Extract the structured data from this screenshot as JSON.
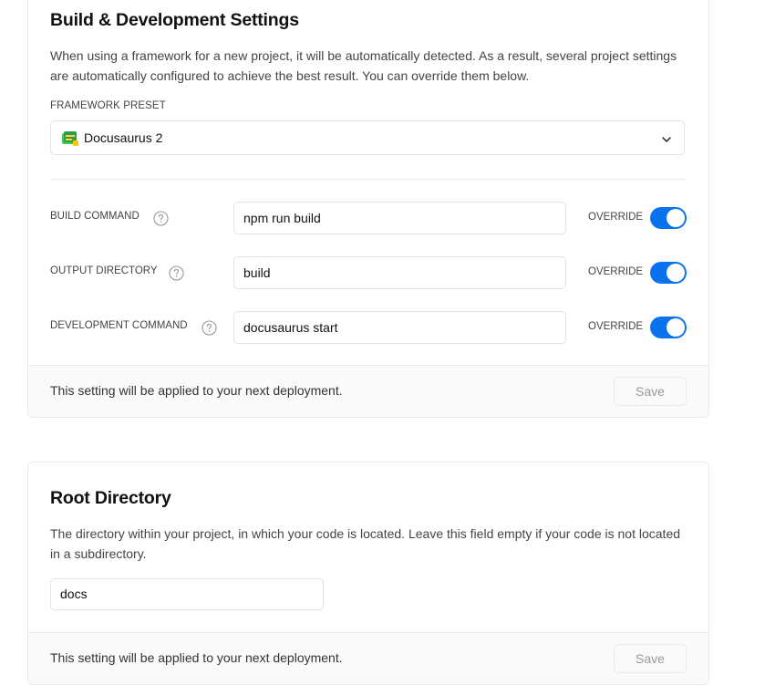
{
  "build_settings": {
    "title": "Build & Development Settings",
    "description": "When using a framework for a new project, it will be automatically detected. As a result, several project settings are automatically configured to achieve the best result. You can override them below.",
    "framework_label": "FRAMEWORK PRESET",
    "framework_value": "Docusaurus 2",
    "framework_icon": "docusaurus-icon",
    "rows": [
      {
        "label": "BUILD COMMAND",
        "value": "npm run build",
        "override_label": "OVERRIDE",
        "override_on": true
      },
      {
        "label": "OUTPUT DIRECTORY",
        "value": "build",
        "override_label": "OVERRIDE",
        "override_on": true
      },
      {
        "label": "DEVELOPMENT COMMAND",
        "value": "docusaurus start",
        "override_label": "OVERRIDE",
        "override_on": true
      }
    ],
    "footer_text": "This setting will be applied to your next deployment.",
    "save_label": "Save"
  },
  "root_directory": {
    "title": "Root Directory",
    "description": "The directory within your project, in which your code is located. Leave this field empty if your code is not located in a subdirectory.",
    "value": "docs",
    "footer_text": "This setting will be applied to your next deployment.",
    "save_label": "Save"
  },
  "colors": {
    "accent": "#0a72ef",
    "border": "#eaeaea",
    "footer_bg": "#fafafa"
  }
}
